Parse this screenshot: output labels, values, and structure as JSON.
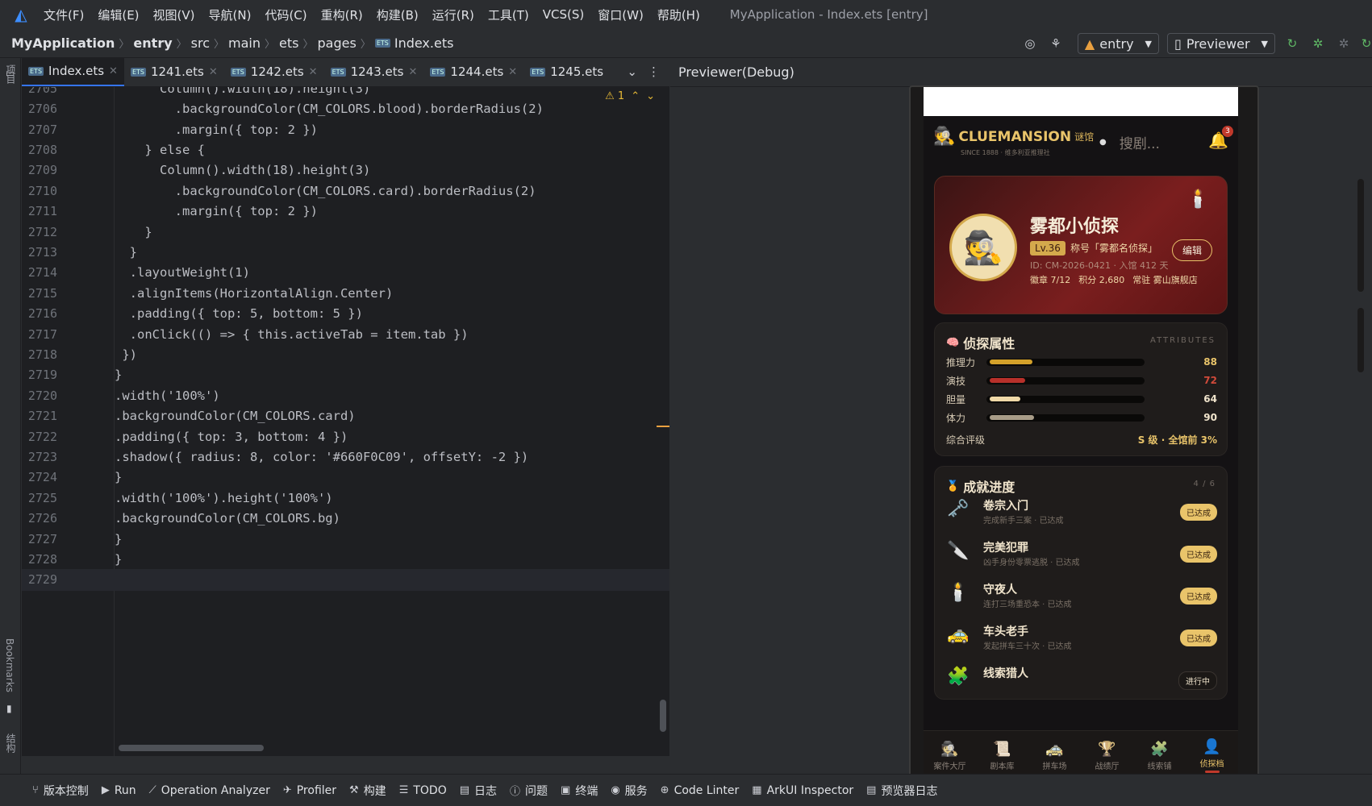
{
  "menu": {
    "items": [
      "文件(F)",
      "编辑(E)",
      "视图(V)",
      "导航(N)",
      "代码(C)",
      "重构(R)",
      "构建(B)",
      "运行(R)",
      "工具(T)",
      "VCS(S)",
      "窗口(W)",
      "帮助(H)"
    ],
    "window_title": "MyApplication - Index.ets [entry]"
  },
  "nav": {
    "breadcrumb": [
      "MyApplication",
      "entry",
      "src",
      "main",
      "ets",
      "pages",
      "Index.ets"
    ],
    "module_combo": "entry",
    "previewer_combo": "Previewer"
  },
  "left_strip": {
    "project": "项目",
    "bookmarks": "Bookmarks",
    "structure": "结构"
  },
  "tabs": [
    "Index.ets",
    "1241.ets",
    "1242.ets",
    "1243.ets",
    "1244.ets",
    "1245.ets"
  ],
  "editor": {
    "warnings": "⚠ 1",
    "lines": [
      {
        "n": "2705",
        "text": "      Column().width(18).height(3)"
      },
      {
        "n": "2706",
        "text": "        .backgroundColor(CM_COLORS.blood).borderRadius(2)"
      },
      {
        "n": "2707",
        "text": "        .margin({ top: 2 })"
      },
      {
        "n": "2708",
        "text": "    } else {"
      },
      {
        "n": "2709",
        "text": "      Column().width(18).height(3)"
      },
      {
        "n": "2710",
        "text": "        .backgroundColor(CM_COLORS.card).borderRadius(2)"
      },
      {
        "n": "2711",
        "text": "        .margin({ top: 2 })"
      },
      {
        "n": "2712",
        "text": "    }"
      },
      {
        "n": "2713",
        "text": "  }"
      },
      {
        "n": "2714",
        "text": "  .layoutWeight(1)"
      },
      {
        "n": "2715",
        "text": "  .alignItems(HorizontalAlign.Center)"
      },
      {
        "n": "2716",
        "text": "  .padding({ top: 5, bottom: 5 })"
      },
      {
        "n": "2717",
        "text": "  .onClick(() => { this.activeTab = item.tab })"
      },
      {
        "n": "2718",
        "text": " })"
      },
      {
        "n": "2719",
        "text": "}"
      },
      {
        "n": "2720",
        "text": ".width('100%')"
      },
      {
        "n": "2721",
        "text": ".backgroundColor(CM_COLORS.card)"
      },
      {
        "n": "2722",
        "text": ".padding({ top: 3, bottom: 4 })"
      },
      {
        "n": "2723",
        "text": ".shadow({ radius: 8, color: '#660F0C09', offsetY: -2 })"
      },
      {
        "n": "2724",
        "text": "}"
      },
      {
        "n": "2725",
        "text": ".width('100%').height('100%')"
      },
      {
        "n": "2726",
        "text": ".backgroundColor(CM_COLORS.bg)"
      },
      {
        "n": "2727",
        "text": "}"
      },
      {
        "n": "2728",
        "text": "}"
      },
      {
        "n": "2729",
        "text": ""
      }
    ]
  },
  "previewer": {
    "title": "Previewer(Debug)",
    "app": {
      "brand": "CLUEMANSION",
      "brand_cn": "谜馆",
      "brand_sub": "SINCE 1888 · 维多利亚推理社",
      "search_placeholder": "搜剧...",
      "notif_count": "3",
      "profile": {
        "name": "雾都小侦探",
        "level": "Lv.36",
        "title": "称号「雾都名侦探」",
        "id": "ID: CM-2026-0421 · 入馆 412 天",
        "stats": [
          "徽章 7/12",
          "积分 2,680",
          "常驻 雾山旗舰店"
        ],
        "edit": "编辑"
      },
      "attributes": {
        "title": "侦探属性",
        "tag": "ATTRIBUTES",
        "items": [
          {
            "label": "推理力",
            "value": "88",
            "level": 0.28,
            "color": "#d4a12a",
            "val_color": "#e9c46a"
          },
          {
            "label": "演技",
            "value": "72",
            "level": 0.23,
            "color": "#b8302a",
            "val_color": "#d04a3a"
          },
          {
            "label": "胆量",
            "value": "64",
            "level": 0.2,
            "color": "#f0d9a8",
            "val_color": "#f0e4cc"
          },
          {
            "label": "体力",
            "value": "90",
            "level": 0.29,
            "color": "#a89c88",
            "val_color": "#f0e4cc"
          }
        ],
        "rating_label": "综合评级",
        "rating_value": "S 级 · 全馆前 3%"
      },
      "achievements": {
        "title": "成就进度",
        "count": "4 / 6",
        "items": [
          {
            "name": "卷宗入门",
            "desc": "完成新手三案 · 已达成",
            "status": "已达成",
            "icon": "key-icon",
            "glyph": "🗝️"
          },
          {
            "name": "完美犯罪",
            "desc": "凶手身份零票逃脱 · 已达成",
            "status": "已达成",
            "icon": "knife-icon",
            "glyph": "🔪"
          },
          {
            "name": "守夜人",
            "desc": "连打三场重恐本 · 已达成",
            "status": "已达成",
            "icon": "candle-icon",
            "glyph": "🕯️"
          },
          {
            "name": "车头老手",
            "desc": "发起拼车三十次 · 已达成",
            "status": "已达成",
            "icon": "taxi-icon",
            "glyph": "🚕"
          },
          {
            "name": "线索猎人",
            "desc": "",
            "status": "进行中",
            "icon": "puzzle-icon",
            "glyph": "🧩"
          }
        ]
      },
      "tabbar": [
        {
          "label": "案件大厅",
          "glyph": "🕵️"
        },
        {
          "label": "剧本库",
          "glyph": "📜"
        },
        {
          "label": "拼车场",
          "glyph": "🚕"
        },
        {
          "label": "战绩厅",
          "glyph": "🏆"
        },
        {
          "label": "线索铺",
          "glyph": "🧩"
        },
        {
          "label": "侦探档",
          "glyph": "👤"
        }
      ]
    }
  },
  "statusbar": [
    {
      "label": "版本控制",
      "icon": "branch-icon",
      "glyph": "⑂"
    },
    {
      "label": "Run",
      "icon": "run-icon",
      "glyph": "▶"
    },
    {
      "label": "Operation Analyzer",
      "icon": "chart-icon",
      "glyph": "⟋"
    },
    {
      "label": "Profiler",
      "icon": "profiler-icon",
      "glyph": "✈"
    },
    {
      "label": "构建",
      "icon": "hammer-icon",
      "glyph": "⚒"
    },
    {
      "label": "TODO",
      "icon": "list-icon",
      "glyph": "☰"
    },
    {
      "label": "日志",
      "icon": "log-icon",
      "glyph": "▤"
    },
    {
      "label": "问题",
      "icon": "problem-icon",
      "glyph": "ⓘ"
    },
    {
      "label": "终端",
      "icon": "terminal-icon",
      "glyph": "▣"
    },
    {
      "label": "服务",
      "icon": "services-icon",
      "glyph": "◉"
    },
    {
      "label": "Code Linter",
      "icon": "linter-icon",
      "glyph": "⊕"
    },
    {
      "label": "ArkUI Inspector",
      "icon": "inspector-icon",
      "glyph": "▦"
    },
    {
      "label": "预览器日志",
      "icon": "preview-log-icon",
      "glyph": "▤"
    }
  ]
}
